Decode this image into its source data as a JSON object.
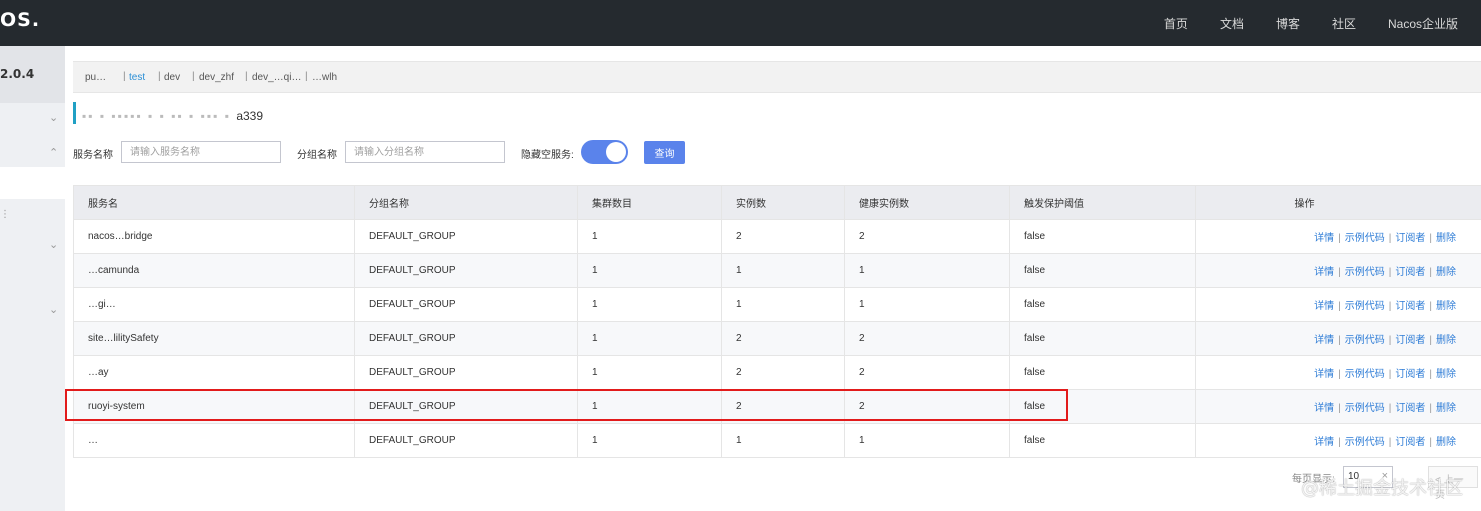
{
  "brand": {
    "logo": "OS.",
    "version": "2.0.4"
  },
  "topnav": [
    "首页",
    "文档",
    "博客",
    "社区",
    "Nacos企业版"
  ],
  "namespaces": [
    {
      "label": "pu…",
      "active": false
    },
    {
      "label": "test",
      "active": true
    },
    {
      "label": "dev",
      "active": false
    },
    {
      "label": "dev_zhf",
      "active": false
    },
    {
      "label": "dev_…qi…",
      "active": false
    },
    {
      "label": "…wlh",
      "active": false
    }
  ],
  "page_title_suffix": "a339",
  "filters": {
    "service_label": "服务名称",
    "service_placeholder": "请输入服务名称",
    "group_label": "分组名称",
    "group_placeholder": "请输入分组名称",
    "hide_empty_label": "隐藏空服务:",
    "hide_empty_on": true,
    "query_button": "查询"
  },
  "table": {
    "headers": [
      "服务名",
      "分组名称",
      "集群数目",
      "实例数",
      "健康实例数",
      "触发保护阈值",
      "操作"
    ],
    "rows": [
      {
        "name": "nacos…bridge",
        "group": "DEFAULT_GROUP",
        "clusters": "1",
        "instances": "2",
        "healthy": "2",
        "threshold": "false"
      },
      {
        "name": "…camunda",
        "group": "DEFAULT_GROUP",
        "clusters": "1",
        "instances": "1",
        "healthy": "1",
        "threshold": "false"
      },
      {
        "name": "…gi…",
        "group": "DEFAULT_GROUP",
        "clusters": "1",
        "instances": "1",
        "healthy": "1",
        "threshold": "false"
      },
      {
        "name": "site…lilitySafety",
        "group": "DEFAULT_GROUP",
        "clusters": "1",
        "instances": "2",
        "healthy": "2",
        "threshold": "false"
      },
      {
        "name": "…ay",
        "group": "DEFAULT_GROUP",
        "clusters": "1",
        "instances": "2",
        "healthy": "2",
        "threshold": "false"
      },
      {
        "name": "ruoyi-system",
        "group": "DEFAULT_GROUP",
        "clusters": "1",
        "instances": "2",
        "healthy": "2",
        "threshold": "false"
      },
      {
        "name": "…",
        "group": "DEFAULT_GROUP",
        "clusters": "1",
        "instances": "1",
        "healthy": "1",
        "threshold": "false"
      }
    ],
    "row_actions": [
      "详情",
      "示例代码",
      "订阅者",
      "删除"
    ]
  },
  "pagination": {
    "label": "每页显示:",
    "page_size": "10",
    "prev": "< 上一页"
  },
  "watermark": "@稀土掘金技术社区",
  "colors": {
    "topbar": "#252a2f",
    "accent": "#5a83eb",
    "link": "#2e7cd6",
    "highlight": "#e21b1b"
  }
}
